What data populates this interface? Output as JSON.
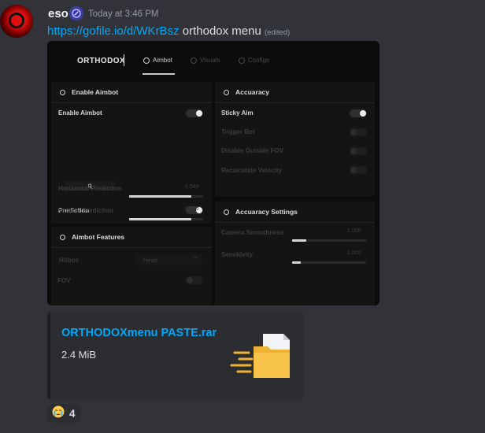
{
  "message": {
    "author": "eso",
    "timestamp": "Today at 3:46 PM",
    "link": "https://gofile.io/d/WKrBsz",
    "text": "orthodox menu",
    "edited": "(edited)"
  },
  "embed_image": {
    "menu_title": "ORTHODOX",
    "tabs": [
      {
        "label": "Aimbot",
        "active": true
      },
      {
        "label": "Visuals",
        "active": false
      },
      {
        "label": "Configs",
        "active": false
      }
    ],
    "enable_aimbot": {
      "title": "Enable Aimbot",
      "enable_label": "Enable Aimbot",
      "enable_on": true,
      "keybind": "q",
      "prediction_label": "Prediction",
      "prediction_on": true,
      "horizontal_label": "Horizontal Prediction",
      "horizontal_value": "6.548",
      "horizontal_fill": 0.84,
      "vertical_label": "Vertical Prediction",
      "vertical_value": "6.500",
      "vertical_fill": 0.84
    },
    "aimbot_features": {
      "title": "Aimbot Features",
      "hitbox_label": "Hitbox",
      "hitbox_value": "Head",
      "fov_label": "FOV",
      "fov_on": false
    },
    "accuracy": {
      "title": "Accuaracy",
      "items": [
        {
          "label": "Sticky Aim",
          "on": true
        },
        {
          "label": "Trigger Bot",
          "on": false
        },
        {
          "label": "Disable Outside FOV",
          "on": false
        },
        {
          "label": "Recalculate Velocity",
          "on": false
        }
      ]
    },
    "accuracy_settings": {
      "title": "Accuaracy Settings",
      "camera_label": "Camera Smoothness",
      "camera_value": "1.000",
      "camera_fill": 0.19,
      "sensitivity_label": "Sensitivity",
      "sensitivity_value": "1.000",
      "sensitivity_fill": 0.12
    }
  },
  "attachment": {
    "filename": "ORTHODOXmenu PASTE.rar",
    "size": "2.4 MiB",
    "icon": "archive-file-icon"
  },
  "reaction": {
    "emoji": "crying-face-icon",
    "count": "4"
  },
  "colors": {
    "background": "#313338",
    "link": "#00a8fc",
    "attachment_bg": "#2b2d31"
  }
}
